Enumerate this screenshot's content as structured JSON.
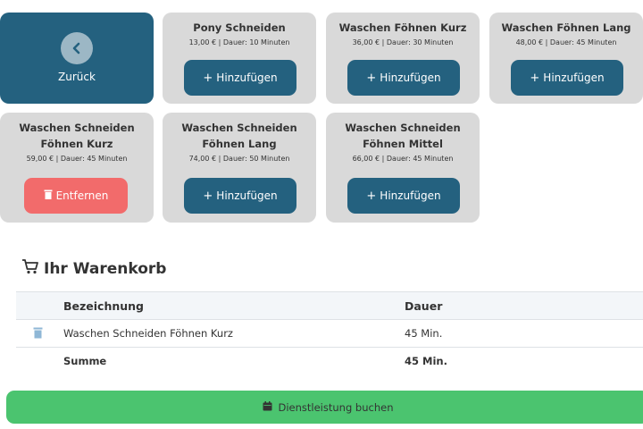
{
  "back": {
    "label": "Zurück"
  },
  "services": [
    {
      "title": "Pony Schneiden",
      "meta": "13,00 € | Dauer: 10 Minuten",
      "action": "Hinzufügen"
    },
    {
      "title": "Waschen Föhnen Kurz",
      "meta": "36,00 € | Dauer: 30 Minuten",
      "action": "Hinzufügen"
    },
    {
      "title": "Waschen Föhnen Lang",
      "meta": "48,00 € | Dauer: 45 Minuten",
      "action": "Hinzufügen"
    },
    {
      "title_line1": "Waschen Schneiden",
      "title_line2": "Föhnen Kurz",
      "meta": "59,00 € | Dauer: 45 Minuten",
      "action": "Entfernen"
    },
    {
      "title_line1": "Waschen Schneiden",
      "title_line2": "Föhnen Lang",
      "meta": "74,00 € | Dauer: 50 Minuten",
      "action": "Hinzufügen"
    },
    {
      "title_line1": "Waschen Schneiden",
      "title_line2": "Föhnen Mittel",
      "meta": "66,00 € | Dauer: 45 Minuten",
      "action": "Hinzufügen"
    }
  ],
  "cart": {
    "title": "Ihr Warenkorb",
    "columns": {
      "name": "Bezeichnung",
      "duration": "Dauer"
    },
    "items": [
      {
        "name": "Waschen Schneiden Föhnen Kurz",
        "duration": "45 Min."
      }
    ],
    "sum_label": "Summe",
    "sum_value": "45 Min."
  },
  "book_button": {
    "label": "Dienstleistung buchen"
  },
  "colors": {
    "primary": "#24617f",
    "danger": "#f26b6b",
    "success": "#4bc46f",
    "tile": "#d9d9d9"
  },
  "icons": [
    "chevron-left-icon",
    "plus-icon",
    "trash-icon",
    "cart-icon",
    "calendar-icon"
  ]
}
